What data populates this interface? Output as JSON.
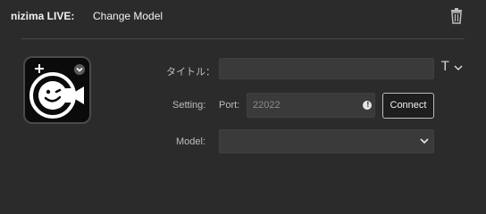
{
  "header": {
    "app_name": "nizima LIVE:",
    "title": "Change Model",
    "trash_icon": "trash-icon"
  },
  "thumbnail": {
    "add_icon": "plus-icon",
    "dropdown_icon": "chevron-down-icon",
    "logo_icon": "nizima-live-logo-icon"
  },
  "form": {
    "title_label": "タイトル：",
    "title_value": "",
    "title_format_icon": "T",
    "setting_label": "Setting:",
    "port_prefix": "Port:",
    "port_placeholder": "22022",
    "port_info_icon": "info-icon",
    "connect_label": "Connect",
    "model_label": "Model:",
    "model_value": ""
  },
  "colors": {
    "background": "#2b2b2b",
    "input_background": "#3a3a3a",
    "button_background": "#1e1e1e",
    "text": "#e6e6e6"
  }
}
